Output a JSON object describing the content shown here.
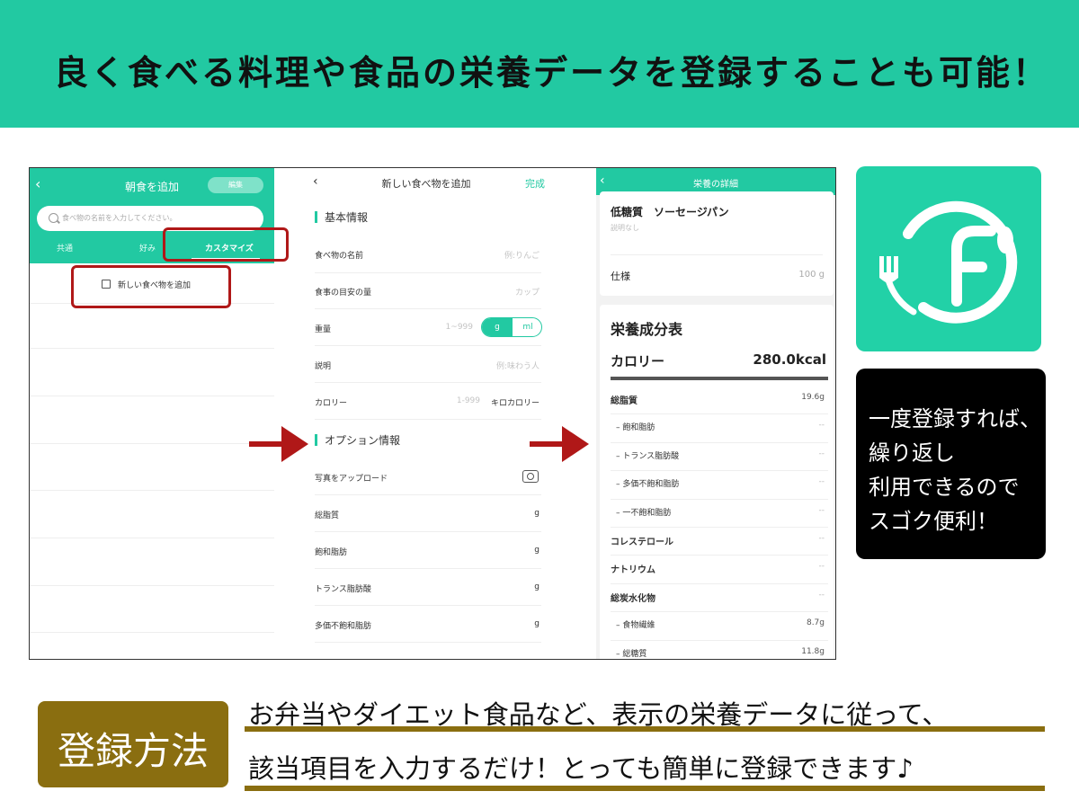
{
  "banner": {
    "title": "良く食べる料理や食品の栄養データを登録することも可能！"
  },
  "panel1": {
    "title": "朝食を追加",
    "edit_label": "編集",
    "search_placeholder": "食べ物の名前を入力してください。",
    "tabs": [
      "共通",
      "好み",
      "カスタマイズ"
    ],
    "active_tab": "カスタマイズ",
    "new_food_label": "新しい食べ物を追加"
  },
  "panel2": {
    "title": "新しい食べ物を追加",
    "done_label": "完成",
    "section_basic": "基本情報",
    "section_options": "オプション情報",
    "rows": [
      {
        "label": "食べ物の名前",
        "value": "例:りんご"
      },
      {
        "label": "食事の目安の量",
        "value": "カップ"
      },
      {
        "label": "重量",
        "value": "1~999"
      },
      {
        "label": "説明",
        "value": "例:味わう人"
      },
      {
        "label": "カロリー",
        "value": "1-999",
        "unit": "キロカロリー"
      }
    ],
    "units": [
      "g",
      "ml"
    ],
    "selected_unit": "g",
    "option_rows": [
      {
        "label": "写真をアップロード",
        "value": ""
      },
      {
        "label": "総脂質",
        "value": "g"
      },
      {
        "label": "飽和脂肪",
        "value": "g"
      },
      {
        "label": "トランス脂肪酸",
        "value": "g"
      },
      {
        "label": "多価不飽和脂肪",
        "value": "g"
      }
    ]
  },
  "panel3": {
    "title": "栄養の詳細",
    "food_name": "低糖質　ソーセージパン",
    "description": "説明なし",
    "spec_label": "仕様",
    "spec_value": "100 g",
    "table_title": "栄養成分表",
    "calorie_label": "カロリー",
    "calorie_value": "280.0kcal",
    "nutrients": [
      {
        "label": "総脂質",
        "value": "19.6g",
        "bold": true,
        "sub": false
      },
      {
        "label": "– 飽和脂肪",
        "value": "--",
        "bold": false,
        "sub": true
      },
      {
        "label": "– トランス脂肪酸",
        "value": "--",
        "bold": false,
        "sub": true
      },
      {
        "label": "– 多価不飽和脂肪",
        "value": "--",
        "bold": false,
        "sub": true
      },
      {
        "label": "– 一不飽和脂肪",
        "value": "--",
        "bold": false,
        "sub": true
      },
      {
        "label": "コレステロール",
        "value": "--",
        "bold": true,
        "sub": false
      },
      {
        "label": "ナトリウム",
        "value": "--",
        "bold": true,
        "sub": false
      },
      {
        "label": "総炭水化物",
        "value": "--",
        "bold": true,
        "sub": false
      },
      {
        "label": "– 食物繊維",
        "value": "8.7g",
        "bold": false,
        "sub": true
      },
      {
        "label": "– 総糖質",
        "value": "11.8g",
        "bold": false,
        "sub": true
      }
    ]
  },
  "callout": {
    "lines": [
      "一度登録すれば、",
      "繰り返し",
      "利用できるので",
      "スゴク便利！"
    ]
  },
  "method": {
    "label": "登録方法",
    "lines": [
      "お弁当やダイエット食品など、表示の栄養データに従って、",
      "該当項目を入力するだけ！とっても簡単に登録できます♪"
    ]
  },
  "colors": {
    "accent": "#22c9a2",
    "highlight_red": "#b01818",
    "badge_gold": "#8a6e10"
  },
  "icons": {
    "app_logo": "fork-spoon-circle-f-logo",
    "arrow": "right-arrow-icon"
  }
}
